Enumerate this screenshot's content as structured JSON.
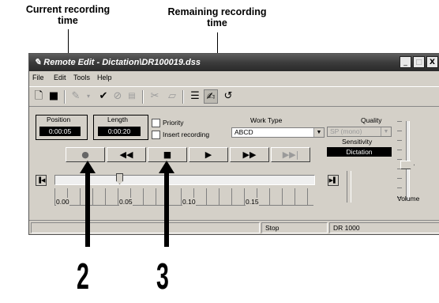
{
  "callouts": {
    "current_recording_time": "Current recording\ntime",
    "remaining_recording_time": "Remaining recording\ntime",
    "step_2": "2",
    "step_3": "3"
  },
  "window": {
    "title": "Remote Edit - Dictation\\DR100019.dss",
    "controls": {
      "minimize": "_",
      "maximize": "□",
      "close": "X"
    }
  },
  "menu": [
    "File",
    "Edit",
    "Tools",
    "Help"
  ],
  "toolbar": {
    "icons": [
      "new-icon",
      "save-icon",
      "pen-icon",
      "check-icon",
      "cancel-icon",
      "id-icon",
      "cut-icon",
      "paste-icon",
      "properties-icon",
      "edit-active-icon",
      "undo-icon"
    ]
  },
  "position": {
    "label": "Position",
    "value": "0:00:05"
  },
  "length": {
    "label": "Length",
    "value": "0:00:20"
  },
  "options": {
    "priority": "Priority",
    "insert_recording": "Insert recording"
  },
  "work_type": {
    "label": "Work Type",
    "value": "ABCD"
  },
  "quality": {
    "label": "Quality",
    "value": "SP (mono)"
  },
  "sensitivity": {
    "label": "Sensitivity",
    "value": "Dictation"
  },
  "transport": {
    "record": "●",
    "rewind": "◀◀",
    "stop": "■",
    "play": "▶",
    "fast_forward": "▶▶",
    "cue_next": "▶▶|"
  },
  "timeline": {
    "ticks": [
      "0.00",
      "0.05",
      "0.10",
      "0.15"
    ],
    "slider_position": 0.25
  },
  "volume": {
    "label": "Volume",
    "level": 0.45
  },
  "statusbar": {
    "state": "Stop",
    "device": "DR 1000"
  },
  "colors": {
    "titlebar": "#3c3c3c",
    "face": "#d4d0c8",
    "lcd": "#000000"
  }
}
